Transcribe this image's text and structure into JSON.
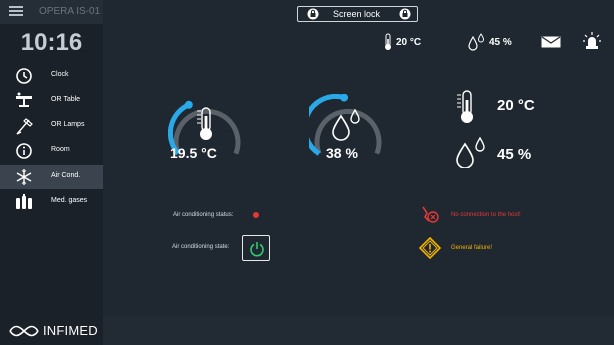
{
  "header": {
    "device_name": "OPERA IS-01",
    "screen_lock_label": "Screen lock",
    "temperature": "20 °C",
    "humidity": "45 %"
  },
  "sidebar": {
    "time": "10:16",
    "items": [
      {
        "label": "Clock",
        "icon": "clock-icon"
      },
      {
        "label": "OR Table",
        "icon": "or-table-icon"
      },
      {
        "label": "OR Lamps",
        "icon": "or-lamp-icon"
      },
      {
        "label": "Room",
        "icon": "info-icon"
      },
      {
        "label": "Air Cond.",
        "icon": "snowflake-icon",
        "active": true
      },
      {
        "label": "Med. gases",
        "icon": "gas-cylinders-icon"
      }
    ],
    "brand": "INFIMED"
  },
  "main": {
    "temperature_gauge": {
      "value": "19.5 °C",
      "fill_fraction": 0.3
    },
    "humidity_gauge": {
      "value": "38 %",
      "fill_fraction": 0.3
    },
    "current_temperature": "20 °C",
    "current_humidity": "45 %",
    "status": {
      "ac_status_label": "Air conditioning status:",
      "ac_status_color": "#e53935",
      "ac_state_label": "Air conditioning state:"
    },
    "warnings": {
      "no_connection": "No connection to the host!",
      "no_connection_color": "#e53935",
      "general_failure": "General failure!",
      "general_failure_color": "#f5b301"
    }
  },
  "colors": {
    "accent": "#2aa9e8",
    "gauge_track": "#5a6168",
    "power_green": "#2ecc71"
  }
}
